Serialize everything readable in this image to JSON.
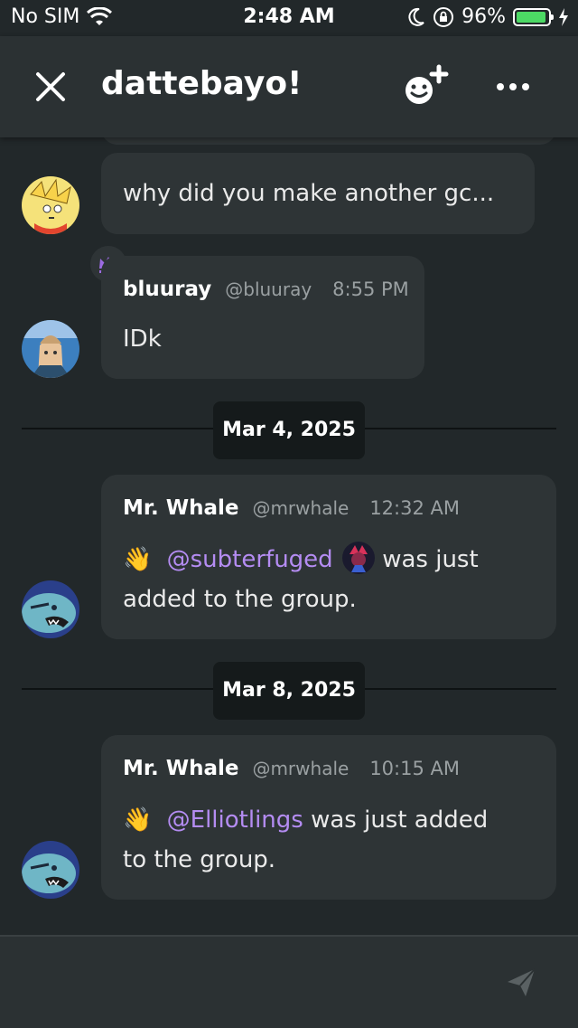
{
  "status_bar": {
    "carrier": "No SIM",
    "time": "2:48 AM",
    "battery": "96%",
    "battery_level": 0.96
  },
  "header": {
    "title": "dattebayo!",
    "icons": {
      "close": "close-icon",
      "add_member": "add-emoji-icon",
      "more": "more-icon"
    }
  },
  "messages": [
    {
      "text": "why did you make another gc..."
    },
    {
      "name": "bluuray",
      "handle": "@bluuray",
      "time": "8:55 PM",
      "text": "IDk",
      "badge": "crown-icon"
    },
    {
      "name": "Mr. Whale",
      "handle": "@mrwhale",
      "time": "12:32 AM",
      "emoji": "👋",
      "mention": "@subterfuged",
      "text_after": "was just",
      "text_line2": "added to the group."
    },
    {
      "name": "Mr. Whale",
      "handle": "@mrwhale",
      "time": "10:15 AM",
      "emoji": "👋",
      "mention": "@Elliotlings",
      "text_after": "was just added",
      "text_line2": "to the group."
    }
  ],
  "dates": [
    "Mar 4, 2025",
    "Mar 8, 2025"
  ],
  "composer": {
    "send_icon": "send-icon"
  },
  "colors": {
    "background": "#22282a",
    "bubble": "#2e3436",
    "mention": "#b48cf2",
    "accent_crown": "#9b6ae0",
    "battery": "#4cd964"
  }
}
